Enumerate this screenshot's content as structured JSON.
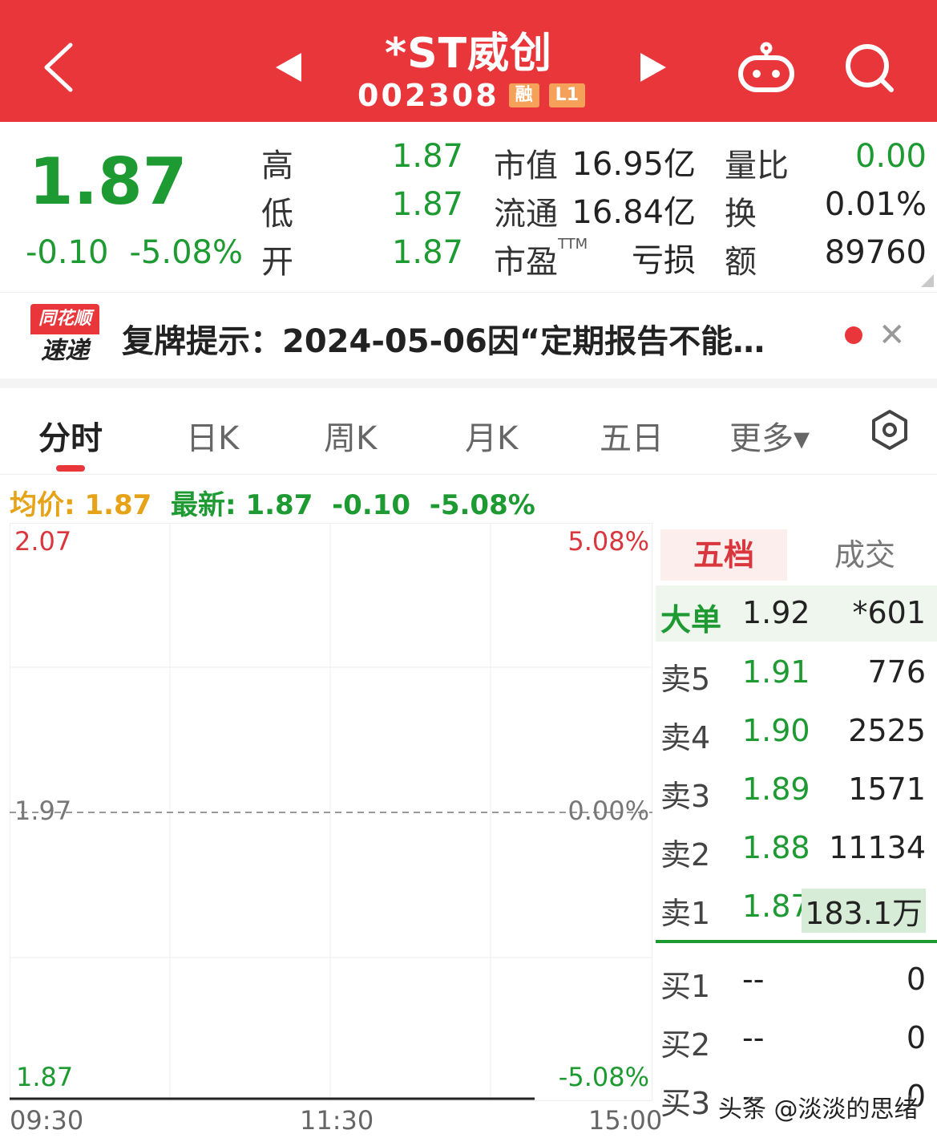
{
  "header": {
    "title": "*ST威创",
    "code": "002308",
    "badges": [
      "融",
      "L1"
    ]
  },
  "quote": {
    "price": "1.87",
    "change": "-0.10",
    "change_pct": "-5.08%",
    "rows": [
      {
        "label": "高",
        "value": "1.87",
        "label2": "市值",
        "value2": "16.95亿",
        "label3": "量比",
        "value3": "0.00"
      },
      {
        "label": "低",
        "value": "1.87",
        "label2": "流通",
        "value2": "16.84亿",
        "label3": "换",
        "value3": "0.01%"
      },
      {
        "label": "开",
        "value": "1.87",
        "label2": "市盈",
        "label2_sup": "TTM",
        "value2": "亏损",
        "label3": "额",
        "value3": "89760"
      }
    ]
  },
  "news": {
    "logo_top": "同花顺",
    "logo_bottom": "速递",
    "text": "复牌提示：2024-05-06因“定期报告不能…"
  },
  "tabs": [
    "分时",
    "日K",
    "周K",
    "月K",
    "五日",
    "更多▾"
  ],
  "infoline": {
    "avg_label": "均价:",
    "avg_value": "1.87",
    "latest_label": "最新:",
    "latest_value": "1.87",
    "latest_change": "-0.10",
    "latest_pct": "-5.08%"
  },
  "chart_data": {
    "type": "line",
    "y_labels_left": [
      "2.07",
      "1.97",
      "1.87"
    ],
    "y_labels_right": [
      "5.08%",
      "0.00%",
      "-5.08%"
    ],
    "x_labels": [
      "09:30",
      "11:30",
      "15:00"
    ],
    "ylim": [
      1.87,
      2.07
    ],
    "series": [
      {
        "x": [
          "09:30",
          "14:16"
        ],
        "values": [
          1.87,
          1.87
        ]
      }
    ]
  },
  "orderbook": {
    "tab_active": "五档",
    "tab_other": "成交",
    "big_order": {
      "label": "大单",
      "price": "1.92",
      "volume": "*601"
    },
    "asks": [
      {
        "label": "卖5",
        "price": "1.91",
        "volume": "776"
      },
      {
        "label": "卖4",
        "price": "1.90",
        "volume": "2525"
      },
      {
        "label": "卖3",
        "price": "1.89",
        "volume": "1571"
      },
      {
        "label": "卖2",
        "price": "1.88",
        "volume": "11134"
      },
      {
        "label": "卖1",
        "price": "1.87",
        "volume": "183.1万"
      }
    ],
    "bids": [
      {
        "label": "买1",
        "price": "--",
        "volume": "0"
      },
      {
        "label": "买2",
        "price": "--",
        "volume": "0"
      },
      {
        "label": "买3",
        "price": "--",
        "volume": "0"
      }
    ]
  },
  "watermark": "头条 @淡淡的思绪",
  "colors": {
    "header": "#e8363b",
    "down": "#1e9a32",
    "up": "#d9363e",
    "avg": "#e6a317"
  }
}
